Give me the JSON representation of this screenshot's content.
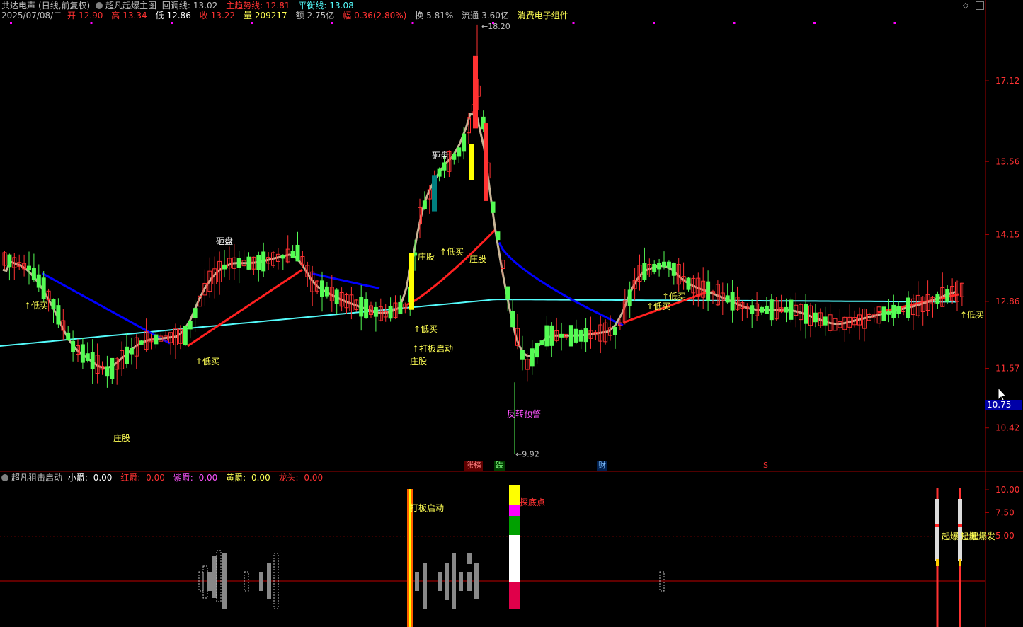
{
  "header": {
    "stock_name": "共达电声",
    "period": "(日线,前复权)",
    "indicator_name": "超凡起爆主图",
    "huitiao_label": "回调线:",
    "huitiao_value": "13.02",
    "zhuqu_label": "主趋势线:",
    "zhuqu_value": "12.81",
    "pingheng_label": "平衡线:",
    "pingheng_value": "13.08",
    "date": "2025/07/08/二",
    "open_label": "开",
    "open": "12.90",
    "high_label": "高",
    "high": "13.34",
    "low_label": "低",
    "low": "12.86",
    "close_label": "收",
    "close": "13.22",
    "volume_label": "量",
    "volume": "209217",
    "amount_label": "额",
    "amount": "2.75亿",
    "change_label": "幅",
    "change": "0.36(2.80%)",
    "turnover_label": "换",
    "turnover": "5.81%",
    "float_label": "流通",
    "float": "3.60亿",
    "sector": "消费电子组件"
  },
  "sub_header": {
    "indicator_name": "超凡狙击启动",
    "xiaojue_label": "小爵:",
    "xiaojue_value": "0.00",
    "hongjue_label": "红爵:",
    "hongjue_value": "0.00",
    "zijue_label": "紫爵:",
    "zijue_value": "0.00",
    "huangjue_label": "黄爵:",
    "huangjue_value": "0.00",
    "longtou_label": "龙头:",
    "longtou_value": "0.00"
  },
  "price_tag": "10.75",
  "flags": {
    "zhangbang": "涨榜",
    "die": "跌",
    "cai": "财",
    "s": "S"
  },
  "window_buttons": {
    "diamond": "◇",
    "scroll": "▯"
  },
  "colors": {
    "up": "#ff3232",
    "down": "#54fc54",
    "ma_blue": "#0000ff",
    "ma_red": "#ff2020",
    "ma_cyan": "#54fcfc",
    "ma_tan": "#c8b496"
  },
  "chart_data": [
    {
      "type": "candlestick",
      "yaxis_ticks": [
        17.12,
        15.56,
        14.15,
        12.86,
        11.57,
        10.42
      ],
      "ylim": [
        9.5,
        18.5
      ],
      "max_marker": "18.20",
      "min_marker": "9.92",
      "last_price": 10.75,
      "annotations": [
        {
          "text": "↑低买",
          "color": "yellow",
          "kind": "low_buy"
        },
        {
          "text": "砸盘",
          "color": "white",
          "kind": "dump"
        },
        {
          "text": "↑低买",
          "color": "yellow",
          "kind": "low_buy"
        },
        {
          "text": "庄股",
          "color": "yellow",
          "kind": "dealer"
        },
        {
          "text": "庄股",
          "color": "yellow",
          "kind": "dealer"
        },
        {
          "text": "↑低买",
          "color": "yellow",
          "kind": "low_buy"
        },
        {
          "text": "↑打板启动",
          "color": "yellow",
          "kind": "limit_start"
        },
        {
          "text": "庄股",
          "color": "yellow",
          "kind": "dealer"
        },
        {
          "text": "↑低买",
          "color": "yellow",
          "kind": "low_buy"
        },
        {
          "text": "砸盘",
          "color": "white",
          "kind": "dump"
        },
        {
          "text": "庄股",
          "color": "yellow",
          "kind": "dealer"
        },
        {
          "text": "反转预警",
          "color": "magenta",
          "kind": "reversal"
        },
        {
          "text": "↑低买",
          "color": "yellow",
          "kind": "low_buy"
        },
        {
          "text": "↑低买",
          "color": "yellow",
          "kind": "low_buy"
        },
        {
          "text": "↑低买",
          "color": "yellow",
          "kind": "low_buy"
        }
      ]
    },
    {
      "type": "bar",
      "yaxis_ticks": [
        10.0,
        7.5,
        5.0
      ],
      "ylim": [
        0,
        11
      ],
      "annotations": [
        {
          "text": "打板启动",
          "color": "yellow"
        },
        {
          "text": "探底点",
          "color": "red"
        },
        {
          "text": "起爆",
          "color": "yellow"
        },
        {
          "text": "起爆",
          "color": "yellow"
        },
        {
          "text": "起爆发",
          "color": "yellow"
        }
      ]
    }
  ]
}
